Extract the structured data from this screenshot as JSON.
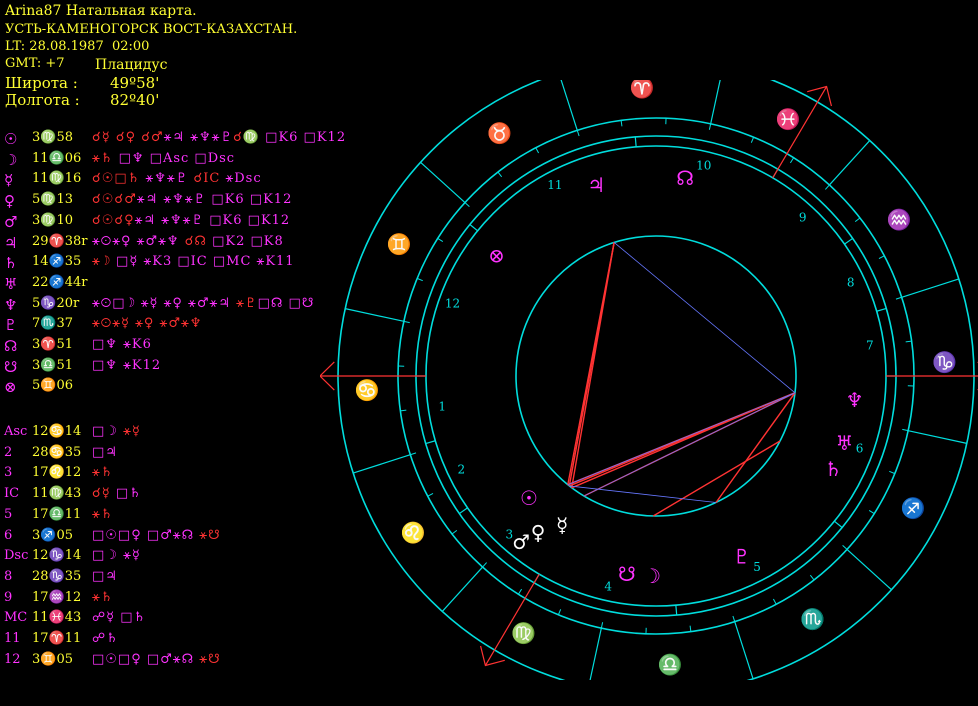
{
  "header": {
    "line1": "Arina87 Натальная карта.",
    "line2": "УСТЬ-КАМЕНОГОРСК ВОСТ-КАЗАХСТАН.",
    "line3": "LT: 28.08.1987  02:00",
    "gmt": "GMT: +7",
    "house_system": "Плацидус",
    "lat_label": "Широта :",
    "lat_value": "49º58'",
    "lon_label": "Долгота :",
    "lon_value": "82º40'"
  },
  "planets": [
    {
      "glyph": "☉",
      "pos": "3♍58",
      "aspects": [
        [
          "☌☿ ☌♀ ",
          "r"
        ],
        [
          "☌♂",
          "r"
        ],
        [
          "⚹♃ ",
          "m"
        ],
        [
          "⚹♆⚹♇",
          "m"
        ],
        [
          "☌♍ ",
          "r"
        ],
        [
          "□K6 □K12",
          "m"
        ]
      ]
    },
    {
      "glyph": "☽",
      "pos": "11♎06",
      "aspects": [
        [
          "⚹♄ ",
          "r"
        ],
        [
          "□♆ □Asc □Dsc",
          "m"
        ]
      ]
    },
    {
      "glyph": "☿",
      "pos": "11♍16",
      "aspects": [
        [
          "☌☉□♄ ",
          "r"
        ],
        [
          "⚹♆⚹♇ ",
          "m"
        ],
        [
          "☌IC ",
          "r"
        ],
        [
          "⚹Dsc",
          "m"
        ]
      ]
    },
    {
      "glyph": "♀",
      "pos": "5♍13",
      "aspects": [
        [
          "☌☉☌♂",
          "r"
        ],
        [
          "⚹♃ ⚹♆⚹♇ ",
          "m"
        ],
        [
          "□K6 □K12",
          "m"
        ]
      ]
    },
    {
      "glyph": "♂",
      "pos": "3♍10",
      "aspects": [
        [
          "☌☉☌♀",
          "r"
        ],
        [
          "⚹♃ ⚹♆⚹♇ ",
          "m"
        ],
        [
          "□K6 □K12",
          "m"
        ]
      ]
    },
    {
      "glyph": "♃",
      "pos": "29♈38r",
      "aspects": [
        [
          "⚹☉⚹♀ ⚹♂⚹♆ ",
          "m"
        ],
        [
          "☌☊ ",
          "r"
        ],
        [
          "□K2 □K8",
          "m"
        ]
      ]
    },
    {
      "glyph": "♄",
      "pos": "14♐35",
      "aspects": [
        [
          "⚹☽ ",
          "r"
        ],
        [
          "□☿ ⚹K3 □IC □MC ⚹K11",
          "m"
        ]
      ]
    },
    {
      "glyph": "♅",
      "pos": "22♐44r",
      "aspects": []
    },
    {
      "glyph": "♆",
      "pos": "5♑20r",
      "aspects": [
        [
          "⚹☉□☽ ⚹☿ ⚹♀ ⚹♂⚹♃ ",
          "m"
        ],
        [
          "⚹♇",
          "r"
        ],
        [
          "□☊ □☋",
          "m"
        ]
      ]
    },
    {
      "glyph": "♇",
      "pos": "7♏37",
      "aspects": [
        [
          "⚹☉⚹☿ ⚹♀ ",
          "r"
        ],
        [
          "⚹♂⚹♆",
          "r"
        ]
      ]
    },
    {
      "glyph": "☊",
      "pos": "3♈51",
      "aspects": [
        [
          "□♆ ⚹K6",
          "m"
        ]
      ]
    },
    {
      "glyph": "☋",
      "pos": "3♎51",
      "aspects": [
        [
          "□♆ ⚹K12",
          "m"
        ]
      ]
    },
    {
      "glyph": "⊗",
      "pos": "5♊06",
      "aspects": []
    }
  ],
  "houses": [
    {
      "label": "Asc",
      "pos": "12♋14",
      "aspects": [
        [
          "□☽ ",
          "m"
        ],
        [
          "⚹☿",
          "r"
        ]
      ]
    },
    {
      "label": "2",
      "pos": "28♋35",
      "aspects": [
        [
          "□♃",
          "m"
        ]
      ]
    },
    {
      "label": "3",
      "pos": "17♌12",
      "aspects": [
        [
          "⚹♄",
          "r"
        ]
      ]
    },
    {
      "label": "IC",
      "pos": "11♍43",
      "aspects": [
        [
          "☌☿ ",
          "r"
        ],
        [
          "□♄",
          "m"
        ]
      ]
    },
    {
      "label": "5",
      "pos": "17♎11",
      "aspects": [
        [
          "⚹♄",
          "r"
        ]
      ]
    },
    {
      "label": "6",
      "pos": "3♐05",
      "aspects": [
        [
          "□☉□♀ □♂⚹☊ ",
          "m"
        ],
        [
          "⚹☋",
          "r"
        ]
      ]
    },
    {
      "label": "Dsc",
      "pos": "12♑14",
      "aspects": [
        [
          "□☽ ⚹☿",
          "m"
        ]
      ]
    },
    {
      "label": "8",
      "pos": "28♑35",
      "aspects": [
        [
          "□♃",
          "m"
        ]
      ]
    },
    {
      "label": "9",
      "pos": "17♒12",
      "aspects": [
        [
          "⚹♄",
          "r"
        ]
      ]
    },
    {
      "label": "MC",
      "pos": "11♓43",
      "aspects": [
        [
          "☍☿ □♄",
          "m"
        ]
      ]
    },
    {
      "label": "11",
      "pos": "17♈11",
      "aspects": [
        [
          "☍♄",
          "m"
        ]
      ]
    },
    {
      "label": "12",
      "pos": "3♊05",
      "aspects": [
        [
          "□☉□♀ □♂⚹☊ ",
          "m"
        ],
        [
          "⚹☋",
          "r"
        ]
      ]
    }
  ],
  "wheel": {
    "zodiac_signs": [
      "♈",
      "♉",
      "♊",
      "♋",
      "♌",
      "♍",
      "♎",
      "♏",
      "♐",
      "♑",
      "♒",
      "♓"
    ],
    "house_numbers": [
      "1",
      "2",
      "3",
      "4",
      "5",
      "6",
      "7",
      "8",
      "9",
      "10",
      "11",
      "12"
    ],
    "planet_glyphs": [
      "☉",
      "☽",
      "☿",
      "♀",
      "♂",
      "♃",
      "♄",
      "♅",
      "♆",
      "♇",
      "☊",
      "☋",
      "⊗"
    ],
    "asc_longitude": 102.23,
    "mc_longitude": 341.72,
    "colors": {
      "circle": "#00dddd",
      "sign": "#ffff33",
      "planet": "#ff33ff",
      "white": "#ffffff",
      "red": "#ff3333",
      "blue": "#6677ff"
    }
  }
}
